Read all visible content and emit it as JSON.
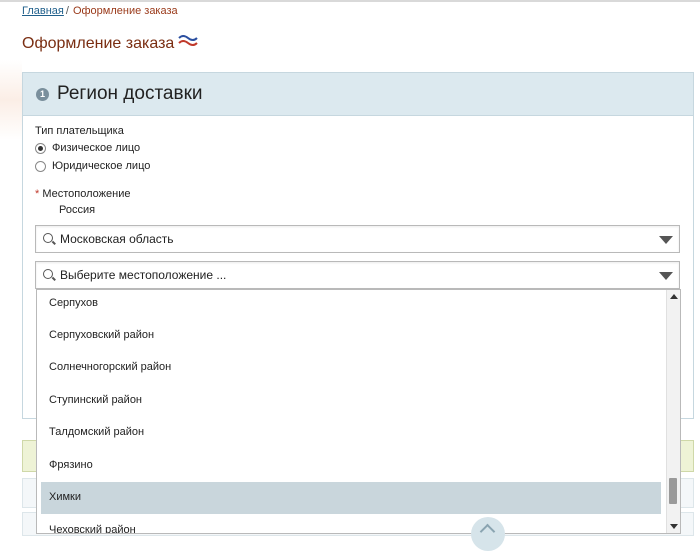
{
  "breadcrumb": {
    "home": "Главная",
    "separator": "/",
    "current": "Оформление заказа"
  },
  "page": {
    "title": "Оформление заказа"
  },
  "panel": {
    "step_number": "1",
    "title": "Регион доставки"
  },
  "payer": {
    "label": "Тип плательщика",
    "options": [
      {
        "label": "Физическое лицо",
        "selected": true
      },
      {
        "label": "Юридическое лицо",
        "selected": false
      }
    ]
  },
  "location": {
    "required_mark": "*",
    "label": "Местоположение",
    "country": "Россия",
    "region_value": "Московская область",
    "city_placeholder": "Выберите местоположение ..."
  },
  "dropdown": {
    "items": [
      "Серпухов",
      "Серпуховский район",
      "Солнечногорский район",
      "Ступинский район",
      "Талдомский район",
      "Фрязино",
      "Химки",
      "Чеховский район"
    ],
    "selected_index": 6
  },
  "colors": {
    "accent": "#7a2e12",
    "panel_header": "#dce9ef",
    "highlight": "#c9d6dc",
    "green_strip": "#eef3d6"
  }
}
